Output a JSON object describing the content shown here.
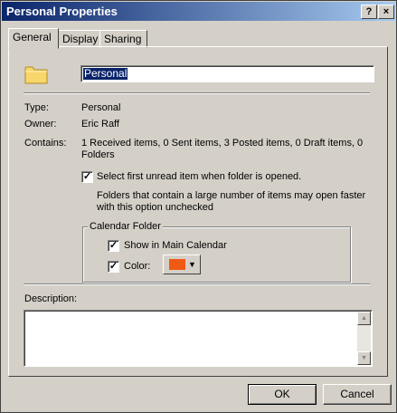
{
  "window": {
    "title": "Personal Properties",
    "help_label": "?",
    "close_label": "×"
  },
  "tabs": [
    {
      "label": "General"
    },
    {
      "label": "Display"
    },
    {
      "label": "Sharing"
    }
  ],
  "name": {
    "value": "Personal"
  },
  "fields": {
    "type_label": "Type:",
    "type_value": "Personal",
    "owner_label": "Owner:",
    "owner_value": "Eric Raff",
    "contains_label": "Contains:",
    "contains_line1": "1 Received items, 0 Sent items, 3 Posted items, 0 Draft items, 0",
    "contains_line2": "Folders"
  },
  "options": {
    "select_first_label": "Select first unread item when folder is opened.",
    "select_first_checked": true,
    "note_line1": "Folders that contain a large number of items may open faster",
    "note_line2": "with this option unchecked"
  },
  "calendar": {
    "group_title": "Calendar Folder",
    "show_label": "Show in Main Calendar",
    "show_checked": true,
    "color_label": "Color:",
    "color_checked": true,
    "color_value": "#f05a14"
  },
  "description": {
    "label": "Description:",
    "value": ""
  },
  "buttons": {
    "ok": "OK",
    "cancel": "Cancel"
  }
}
